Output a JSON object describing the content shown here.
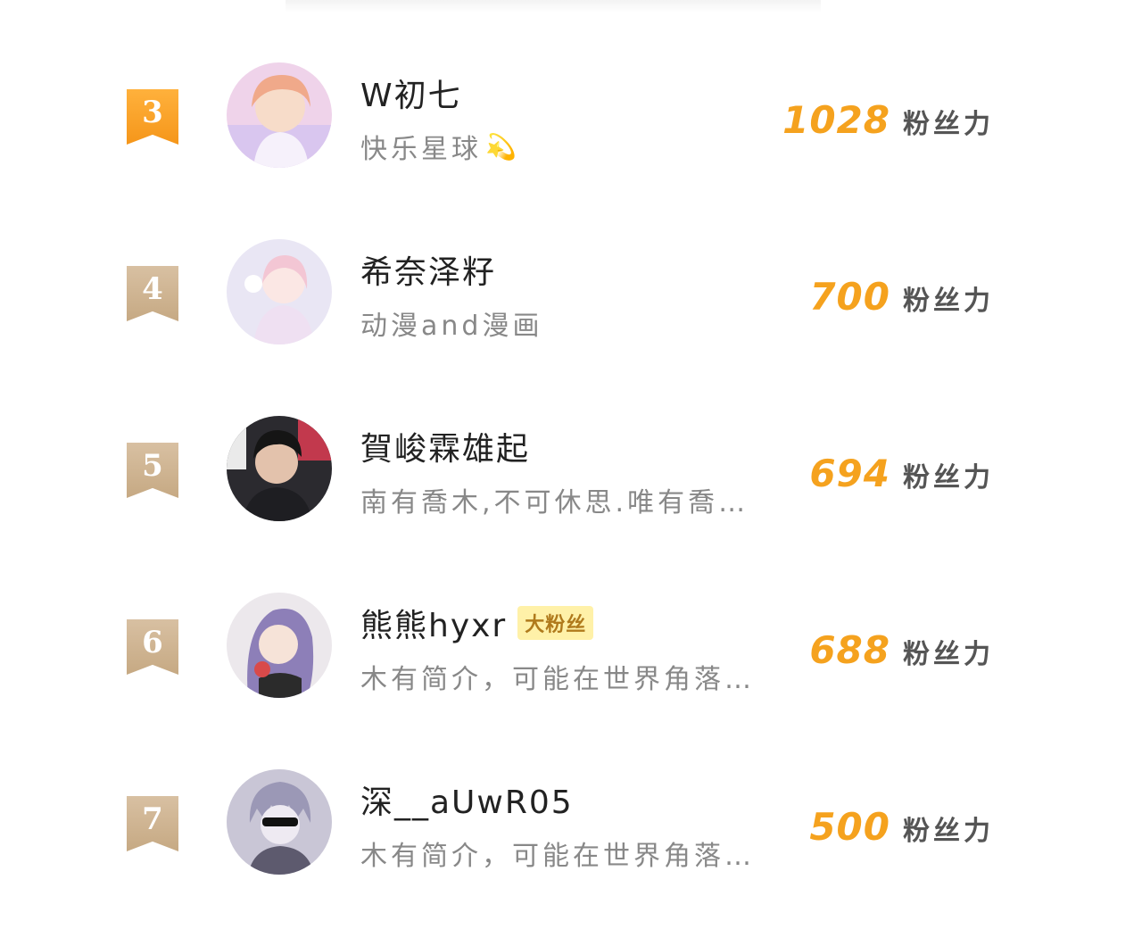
{
  "accent_color": "#f5a21e",
  "unit_label": "粉丝力",
  "entries": [
    {
      "rank": "3",
      "name": "W初七",
      "bio": "快乐星球",
      "bio_icon": "shooting-star-icon",
      "score": "1028",
      "badge": "",
      "rank_color": "#f5a01f"
    },
    {
      "rank": "4",
      "name": "希奈泽籽",
      "bio": "动漫and漫画",
      "score": "700",
      "badge": "",
      "rank_color": "#ccb18e"
    },
    {
      "rank": "5",
      "name": "賀峻霖雄起",
      "bio": "南有喬木,不可休思.唯有喬…",
      "score": "694",
      "badge": "",
      "rank_color": "#ccb18e"
    },
    {
      "rank": "6",
      "name": "熊熊hyxr",
      "bio": "木有简介，可能在世界角落…",
      "score": "688",
      "badge": "大粉丝",
      "rank_color": "#ccb18e"
    },
    {
      "rank": "7",
      "name": "深__aUwR05",
      "bio": "木有简介，可能在世界角落…",
      "score": "500",
      "badge": "",
      "rank_color": "#ccb18e"
    }
  ]
}
